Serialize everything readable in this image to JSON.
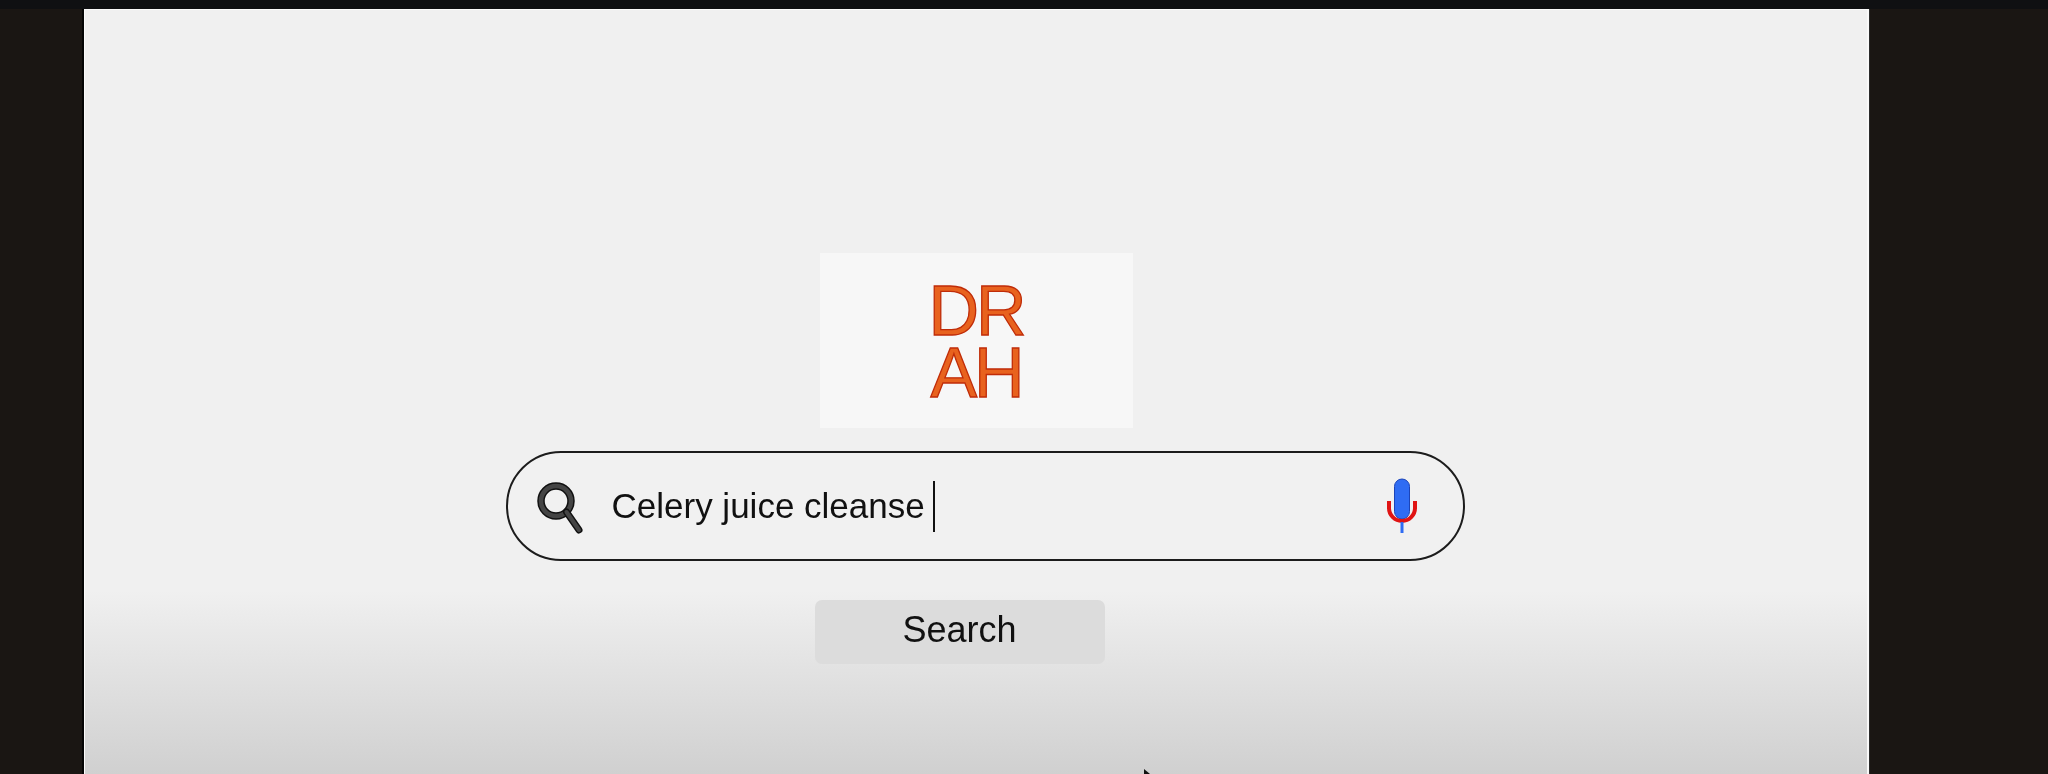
{
  "logo": {
    "lines": [
      "DR",
      "AH"
    ]
  },
  "search_field": {
    "value": "Celery juice cleanse",
    "focused": true
  },
  "search_button": {
    "label": "Search"
  }
}
